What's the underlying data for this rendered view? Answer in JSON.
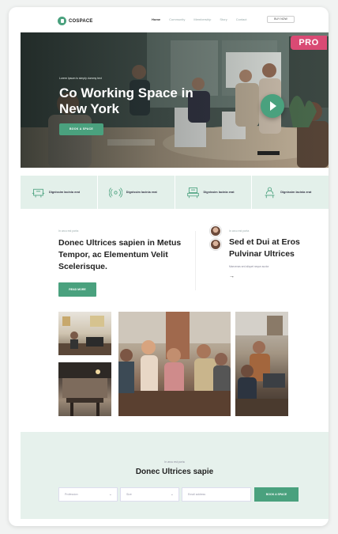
{
  "badge": {
    "label": "PRO"
  },
  "nav": {
    "logo": "COSPACE",
    "links": [
      {
        "label": "Home",
        "active": true
      },
      {
        "label": "Community",
        "active": false
      },
      {
        "label": "Membership",
        "active": false
      },
      {
        "label": "Story",
        "active": false
      },
      {
        "label": "Contact",
        "active": false
      }
    ],
    "cta": "BUY NOW"
  },
  "hero": {
    "tagline": "Lorem Ipsum is simply dummy text",
    "title": "Co Working Space in New York",
    "button": "BOOK A SPACE"
  },
  "features": [
    {
      "icon": "workspace-icon",
      "label": "Dignissim lacinia erat"
    },
    {
      "icon": "wifi-icon",
      "label": "Dignissim lacinia erat"
    },
    {
      "icon": "lounge-icon",
      "label": "Dignissim lacinia erat"
    },
    {
      "icon": "meeting-icon",
      "label": "Dignissim lacinia erat"
    }
  ],
  "about": {
    "kicker": "In arcu est porta",
    "title": "Donec Ultrices sapien in Metus Tempor, ac Elementum Velit Scelerisque.",
    "button": "READ MORE"
  },
  "aside": {
    "kicker": "In arcu est porta",
    "title": "Sed et Dui at Eros Pulvinar Ultrices",
    "subtitle": "Maecenas sed aliquet neque auctor",
    "arrow": "→"
  },
  "booking": {
    "kicker": "In arcu est porta",
    "title": "Donec Ultrices sapie",
    "fields": [
      {
        "placeholder": "Profession"
      },
      {
        "placeholder": "Size"
      },
      {
        "placeholder": "Email address"
      }
    ],
    "button": "BOOK A SPACE"
  },
  "colors": {
    "accent": "#4aa17e",
    "badge": "#d94a74",
    "mint": "#e3f0ea"
  }
}
